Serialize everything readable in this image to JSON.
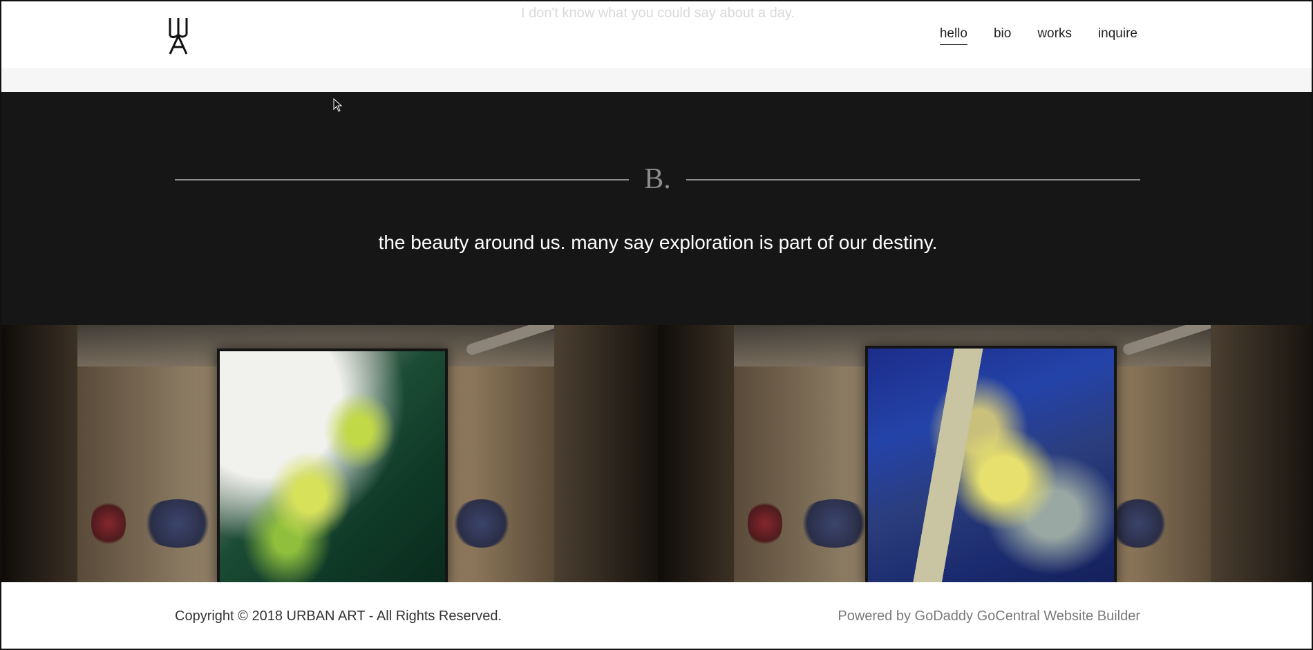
{
  "header": {
    "ghost_text": "I don't know what you could say about a day.",
    "logo_alt": "UA logo",
    "nav": [
      {
        "label": "hello",
        "active": true
      },
      {
        "label": "bio",
        "active": false
      },
      {
        "label": "works",
        "active": false
      },
      {
        "label": "inquire",
        "active": false
      }
    ]
  },
  "hero": {
    "mark": "B.",
    "tagline": "the beauty around us. many say exploration is part of our destiny."
  },
  "gallery": {
    "images": [
      {
        "name": "green-abstract-painting"
      },
      {
        "name": "blue-abstract-painting"
      }
    ]
  },
  "footer": {
    "copyright": "Copyright © 2018 URBAN ART - All Rights Reserved.",
    "powered": "Powered by GoDaddy GoCentral Website Builder"
  },
  "colors": {
    "dark_bg": "#161616",
    "rule": "#8e8e8e",
    "mark": "#8c8c8c"
  }
}
